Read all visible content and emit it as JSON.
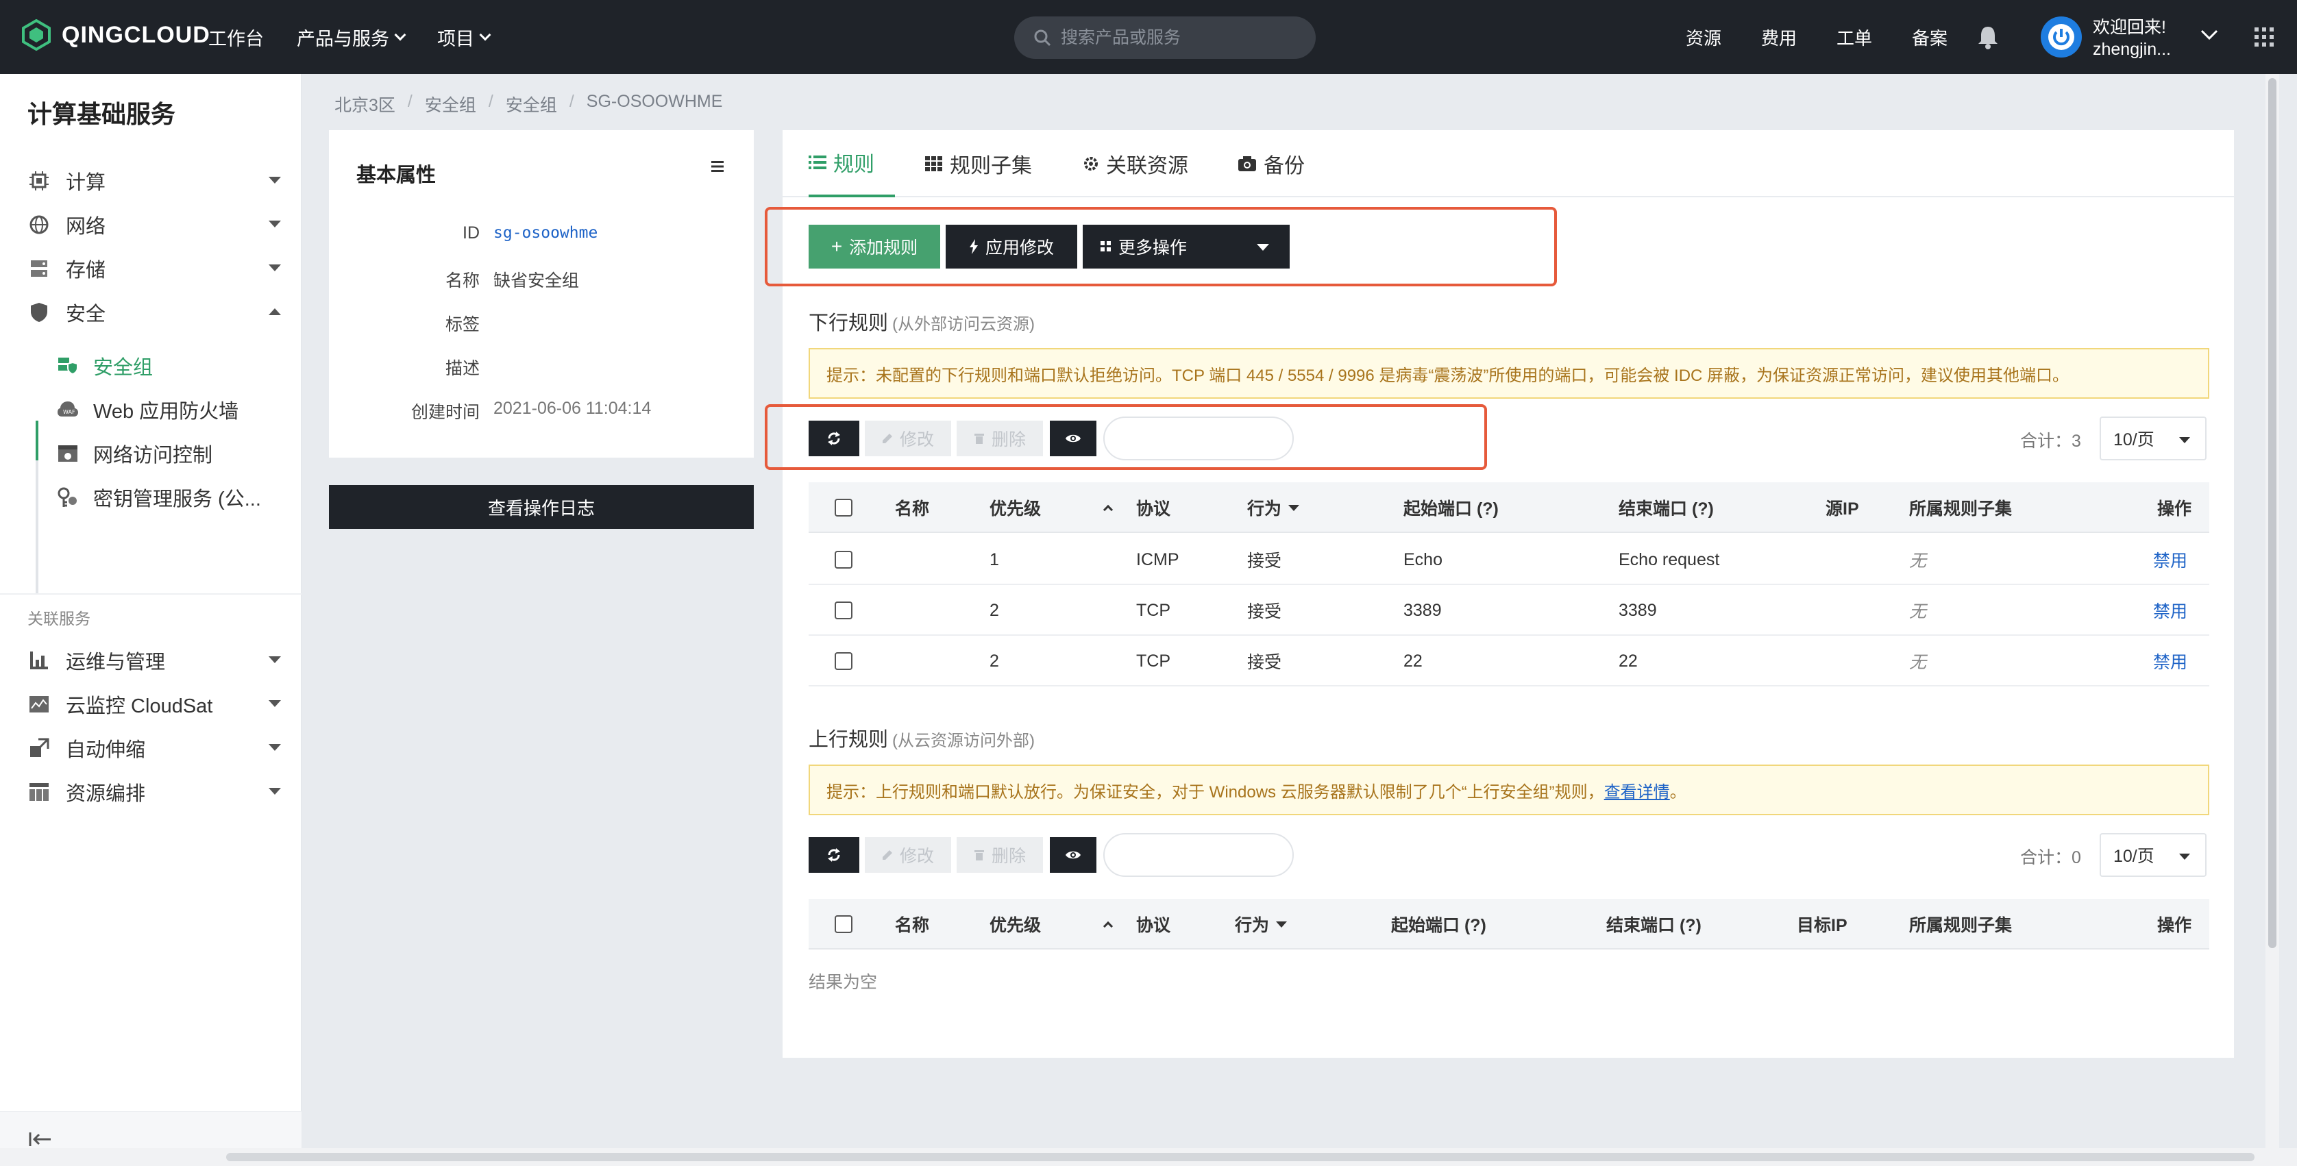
{
  "topbar": {
    "logo": "QINGCLOUD",
    "nav": [
      "工作台",
      "产品与服务",
      "项目"
    ],
    "search_placeholder": "搜索产品或服务",
    "right_links": [
      "资源",
      "费用",
      "工单",
      "备案"
    ],
    "welcome": "欢迎回来!",
    "username": "zhengjin..."
  },
  "sidebar": {
    "title": "计算基础服务",
    "items": [
      "计算",
      "网络",
      "存储",
      "安全"
    ],
    "security_sub": [
      "安全组",
      "Web 应用防火墙",
      "网络访问控制",
      "密钥管理服务 (公..."
    ],
    "group_label": "关联服务",
    "related": [
      "运维与管理",
      "云监控 CloudSat",
      "自动伸缩",
      "资源编排"
    ]
  },
  "breadcrumb": [
    "北京3区",
    "安全组",
    "安全组",
    "SG-OSOOWHME"
  ],
  "basic": {
    "title": "基本属性",
    "labels": [
      "ID",
      "名称",
      "标签",
      "描述",
      "创建时间"
    ],
    "values": [
      "sg-osoowhme",
      "缺省安全组",
      "",
      "",
      "2021-06-06 11:04:14"
    ],
    "log_button": "查看操作日志"
  },
  "tabs": [
    "规则",
    "规则子集",
    "关联资源",
    "备份"
  ],
  "actions": {
    "add": "添加规则",
    "apply": "应用修改",
    "more": "更多操作",
    "edit": "修改",
    "delete": "删除"
  },
  "ingress": {
    "title": "下行规则",
    "hint": "(从外部访问云资源)",
    "notice": "提示：未配置的下行规则和端口默认拒绝访问。TCP 端口 445 / 5554 / 9996 是病毒“震荡波”所使用的端口，可能会被 IDC 屏蔽，为保证资源正常访问，建议使用其他端口。",
    "total": "合计：3",
    "page_size": "10/页",
    "columns": [
      "名称",
      "优先级",
      "协议",
      "行为",
      "起始端口 (?)",
      "结束端口 (?)",
      "源IP",
      "所属规则子集",
      "操作"
    ],
    "rows": [
      {
        "name": "",
        "priority": "1",
        "protocol": "ICMP",
        "action": "接受",
        "start": "Echo",
        "end": "Echo request",
        "ip": "",
        "subset": "无",
        "op": "禁用"
      },
      {
        "name": "",
        "priority": "2",
        "protocol": "TCP",
        "action": "接受",
        "start": "3389",
        "end": "3389",
        "ip": "",
        "subset": "无",
        "op": "禁用"
      },
      {
        "name": "",
        "priority": "2",
        "protocol": "TCP",
        "action": "接受",
        "start": "22",
        "end": "22",
        "ip": "",
        "subset": "无",
        "op": "禁用"
      }
    ]
  },
  "egress": {
    "title": "上行规则",
    "hint": "(从云资源访问外部)",
    "notice_text": "提示：上行规则和端口默认放行。为保证安全，对于 Windows 云服务器默认限制了几个“上行安全组”规则，",
    "notice_link": "查看详情",
    "notice_end": "。",
    "total": "合计：0",
    "page_size": "10/页",
    "columns": [
      "名称",
      "优先级",
      "协议",
      "行为",
      "起始端口 (?)",
      "结束端口 (?)",
      "目标IP",
      "所属规则子集",
      "操作"
    ],
    "empty": "结果为空"
  },
  "colors": {
    "accent": "#2f9e67",
    "dark": "#1f2329",
    "highlight": "#e65a3b",
    "link": "#1e63c7"
  }
}
